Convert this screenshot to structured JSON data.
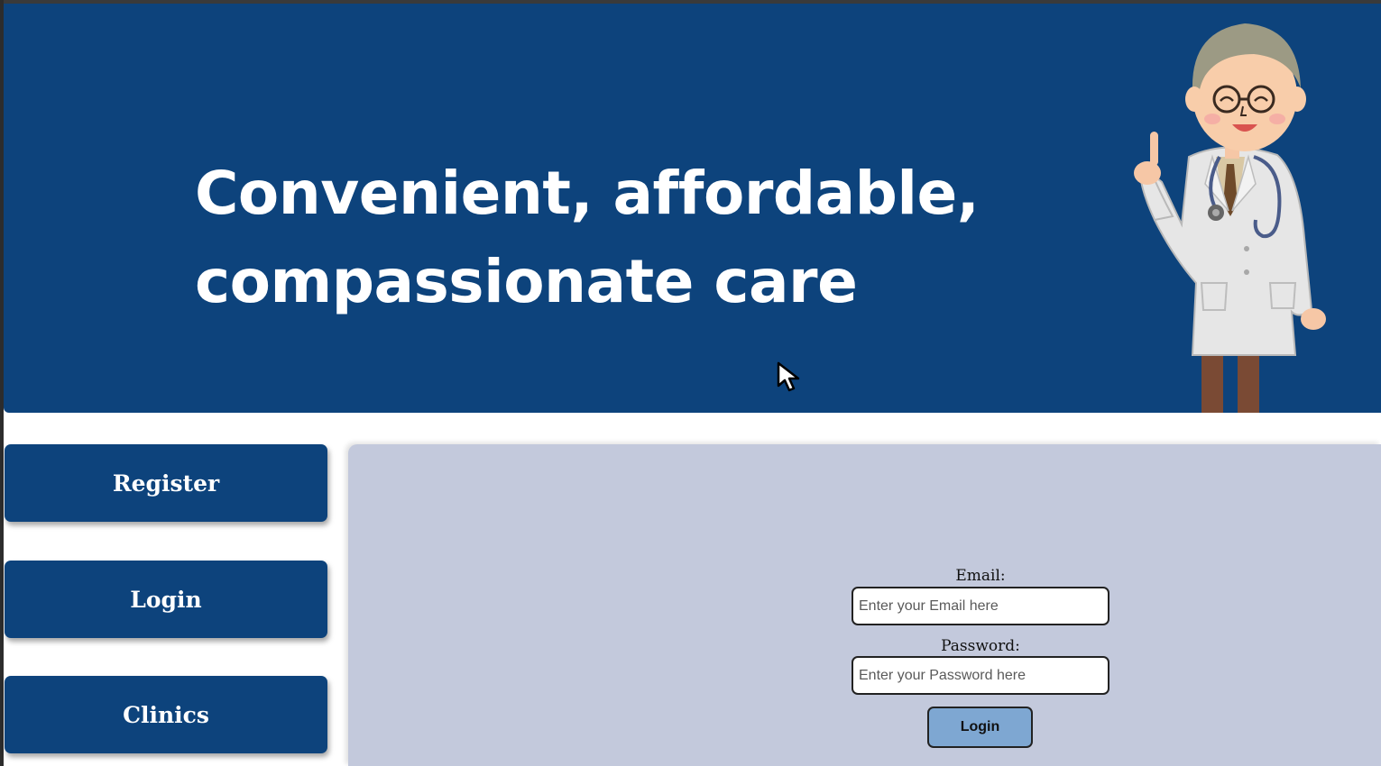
{
  "banner": {
    "headline_line1": "Convenient, affordable,",
    "headline_line2": "compassionate care",
    "illustration": "doctor-illustration"
  },
  "sidebar": {
    "items": [
      {
        "label": "Register"
      },
      {
        "label": "Login"
      },
      {
        "label": "Clinics"
      }
    ]
  },
  "login_form": {
    "email_label": "Email:",
    "email_placeholder": "Enter your Email here",
    "password_label": "Password:",
    "password_placeholder": "Enter your Password here",
    "submit_label": "Login"
  },
  "colors": {
    "brand_navy": "#0d437c",
    "content_panel": "#c3c9dc",
    "submit_button": "#7ea7d2"
  }
}
